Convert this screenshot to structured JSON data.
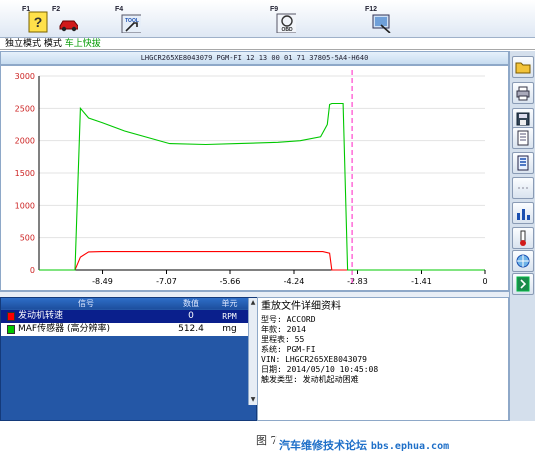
{
  "toolbar": {
    "keys": [
      {
        "label": "F1",
        "icon": "help-icon"
      },
      {
        "label": "F2",
        "icon": "car-icon"
      },
      {
        "label": "F4",
        "icon": "tool-icon",
        "badge": "TOOL"
      },
      {
        "label": "F9",
        "icon": "obd-icon",
        "badge": "OBD"
      },
      {
        "label": "F12",
        "icon": "print-screen-icon"
      }
    ]
  },
  "mode_bar": {
    "prefix": "独立模式 模式 ",
    "highlight": "车上快拔"
  },
  "chart": {
    "header": "LHGCR265XE8043079  PGM-FI  12 13 00 01 71  37805-5A4-H640",
    "colors": {
      "rpm": "#ff0000",
      "maf": "#00c800",
      "cursor": "#ff44cc",
      "axis": "#000000",
      "tick_text": "#cc2222"
    }
  },
  "chart_data": {
    "type": "line",
    "ylim": [
      0,
      3000
    ],
    "y_ticks": [
      "3000",
      "2500",
      "2000",
      "1500",
      "1000",
      "500",
      "0"
    ],
    "xlim": [
      -9.9,
      0
    ],
    "x_ticks": [
      "-8.49",
      "-7.07",
      "-5.66",
      "-4.24",
      "-2.83",
      "-1.41",
      "0"
    ],
    "cursor_x": -2.95,
    "series": [
      {
        "name": "发动机转速",
        "color": "#ff0000",
        "x": [
          -9.9,
          -9.1,
          -8.98,
          -8.8,
          -8.5,
          -3.6,
          -3.45,
          -3.4,
          -0.01
        ],
        "y": [
          0,
          0,
          200,
          280,
          285,
          285,
          260,
          0,
          0
        ]
      },
      {
        "name": "MAF传感器(高分辨率)",
        "color": "#00c800",
        "x": [
          -9.9,
          -9.1,
          -8.98,
          -8.8,
          -8.5,
          -8.0,
          -7.0,
          -6.2,
          -5.5,
          -4.6,
          -4.1,
          -3.65,
          -3.5,
          -3.45,
          -3.4,
          -3.15,
          -3.05,
          -0.01
        ],
        "y": [
          0,
          0,
          2500,
          2350,
          2280,
          2150,
          1955,
          1940,
          1955,
          1975,
          2000,
          2060,
          2250,
          2560,
          2575,
          2575,
          0,
          0
        ]
      }
    ]
  },
  "table": {
    "headers": [
      "信号",
      "数值",
      "单元"
    ],
    "rows": [
      {
        "signal": "发动机转速",
        "value": "0",
        "unit": "RPM",
        "color": "#ff0000"
      },
      {
        "signal": "MAF传感器 (高分辨率)",
        "value": "512.4",
        "unit": "mg",
        "color": "#00c800"
      }
    ]
  },
  "details": {
    "title": "重放文件详细资料",
    "lines": [
      "型号: ACCORD",
      "年款: 2014",
      "里程表: 55",
      "系统: PGM-FI",
      "VIN: LHGCR265XE8043079",
      "日期: 2014/05/10 10:45:08",
      "触发类型: 发动机起动困难"
    ]
  },
  "caption": "图 7",
  "watermark": {
    "text": "汽车维修技术论坛",
    "url": "bbs.ephua.com"
  }
}
